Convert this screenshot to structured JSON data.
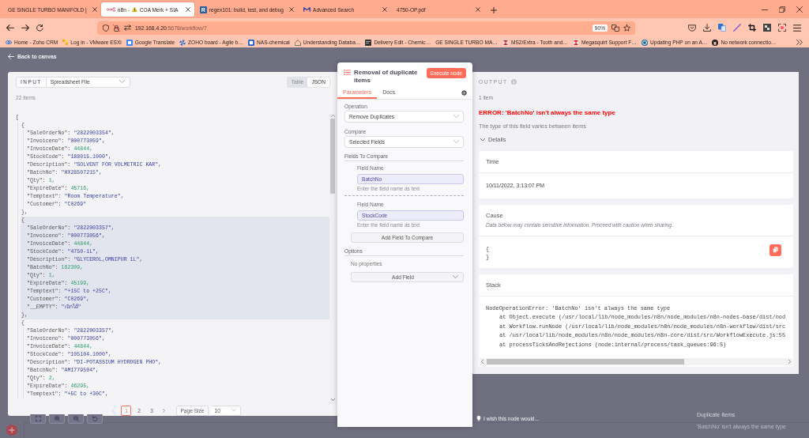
{
  "browser": {
    "tabs": [
      {
        "label": "GE SINGLE TURBO MANIFOLD |",
        "kind": "plain",
        "warning": false,
        "selected": false
      },
      {
        "label": "n8n -",
        "label_2": "COA Merk + SIA",
        "kind": "nodes",
        "warning": true,
        "selected": true
      },
      {
        "label": "regex101: build, test, and debug",
        "kind": "letter",
        "favicon_text": "R",
        "warning": false,
        "selected": false
      },
      {
        "label": "Advanced Search",
        "kind": "zigzag",
        "warning": false,
        "selected": false
      },
      {
        "label": "4750-OP.pdf",
        "kind": "plain",
        "warning": false,
        "selected": false
      }
    ],
    "address": {
      "host": "192.168.4.20",
      "path": ":5678/workflow/7",
      "zoom": "90%"
    },
    "bookmarks": [
      {
        "label": "Home - Zoho CRM",
        "kind": "rings"
      },
      {
        "label": "Log in - VMware ESXi",
        "kind": "squares"
      },
      {
        "label": "Google Translate",
        "kind": "tile"
      },
      {
        "label": "ZOHO board - Agile b…",
        "kind": "pinwheel"
      },
      {
        "label": "NAS-chemical",
        "kind": "screen"
      },
      {
        "label": "Understanding Databa…",
        "kind": "house"
      },
      {
        "label": "Delivery Edit - Chemic…",
        "kind": "terminal"
      },
      {
        "label": "GE SINGLE TURBO MA…",
        "kind": "plain"
      },
      {
        "label": "MS2/Extra - Tooth and…",
        "kind": "hourglass"
      },
      {
        "label": "Megasquirt Support F…",
        "kind": "hourglass"
      },
      {
        "label": "Updating PHP on an A…",
        "kind": "circle"
      },
      {
        "label": "No network connectio…",
        "kind": "cat"
      }
    ]
  },
  "back_link": "Back to canvas",
  "input": {
    "label": "INPUT",
    "source": "Spreadsheet File",
    "views": [
      {
        "label": "Table",
        "selected": false
      },
      {
        "label": "JSON",
        "selected": true
      }
    ],
    "count": "22 items",
    "json": {
      "open": "[",
      "items": [
        {
          "open": "{",
          "close": "},",
          "highlighted": false,
          "fields": [
            {
              "key": "\"SaleOrderNo\":",
              "value": "\"2822003354\",",
              "kind": "string"
            },
            {
              "key": "\"Invoiceno\":",
              "value": "\"000773059\",",
              "kind": "string"
            },
            {
              "key": "\"InvoiceDate\":",
              "value": "44844,",
              "kind": "number"
            },
            {
              "key": "\"StockCode\":",
              "value": "\"188015.1000\",",
              "kind": "string"
            },
            {
              "key": "\"Description\":",
              "value": "\"SOLVENT FOR VOLMETRIC KAR\",",
              "kind": "string"
            },
            {
              "key": "\"BatchNo\":",
              "value": "\"HX28507215\",",
              "kind": "string"
            },
            {
              "key": "\"Qty\":",
              "value": "1,",
              "kind": "number"
            },
            {
              "key": "\"ExpireDate\":",
              "value": "45716,",
              "kind": "number"
            },
            {
              "key": "\"Temptext\":",
              "value": "\"Room Temperature\",",
              "kind": "string"
            },
            {
              "key": "\"Customer\":",
              "value": "\"C0269\"",
              "kind": "string"
            }
          ]
        },
        {
          "open": "{",
          "close": "},",
          "highlighted": true,
          "fields": [
            {
              "key": "\"SaleOrderNo\":",
              "value": "\"2822003357\",",
              "kind": "string"
            },
            {
              "key": "\"Invoiceno\":",
              "value": "\"000773056\",",
              "kind": "string"
            },
            {
              "key": "\"InvoiceDate\":",
              "value": "44844,",
              "kind": "number"
            },
            {
              "key": "\"StockCode\":",
              "value": "\"4750-1L\",",
              "kind": "string"
            },
            {
              "key": "\"Description\":",
              "value": "\"GLYCEROL,OMNIPUR 1L\",",
              "kind": "string"
            },
            {
              "key": "\"BatchNo\":",
              "value": "162309,",
              "kind": "number"
            },
            {
              "key": "\"Qty\":",
              "value": "1,",
              "kind": "number"
            },
            {
              "key": "\"ExpireDate\":",
              "value": "45199,",
              "kind": "number"
            },
            {
              "key": "\"Temptext\":",
              "value": "\"+15C to +25C\",",
              "kind": "string"
            },
            {
              "key": "\"Customer\":",
              "value": "\"C0269\",",
              "kind": "string"
            },
            {
              "key": "\"__EMPTY\":",
              "value": "\"เบิกได้\"",
              "kind": "string"
            }
          ]
        },
        {
          "open": "{",
          "highlighted": false,
          "fields": [
            {
              "key": "\"SaleOrderNo\":",
              "value": "\"2822003357\",",
              "kind": "string"
            },
            {
              "key": "\"Invoiceno\":",
              "value": "\"000773056\",",
              "kind": "string"
            },
            {
              "key": "\"InvoiceDate\":",
              "value": "44844,",
              "kind": "number"
            },
            {
              "key": "\"StockCode\":",
              "value": "\"105104.1000\",",
              "kind": "string"
            },
            {
              "key": "\"Description\":",
              "value": "\"DI-POTASSIUM HYDROGEN PHO\",",
              "kind": "string"
            },
            {
              "key": "\"BatchNo\":",
              "value": "\"AM1779504\",",
              "kind": "string"
            },
            {
              "key": "\"Qty\":",
              "value": "2,",
              "kind": "number"
            },
            {
              "key": "\"ExpireDate\":",
              "value": "46295,",
              "kind": "number"
            },
            {
              "key": "\"Temptext\":",
              "value": "\"+5C to +30C\",",
              "kind": "string"
            }
          ]
        }
      ]
    },
    "pagination": {
      "prev_disabled": true,
      "pages": [
        {
          "label": "1",
          "selected": true
        },
        {
          "label": "2",
          "selected": false
        },
        {
          "label": "3",
          "selected": false
        }
      ],
      "page_size_label": "Page Size",
      "page_size": "10"
    }
  },
  "parameters_panel": {
    "title": "Removal of duplicate items",
    "execute": "Execute node",
    "tabs": [
      {
        "label": "Parameters",
        "selected": true
      },
      {
        "label": "Docs",
        "selected": false
      }
    ],
    "items": [
      {
        "kind": "select",
        "label": "Operation",
        "value": "Remove Duplicates"
      },
      {
        "kind": "select",
        "label": "Compare",
        "value": "Selected Fields"
      },
      {
        "kind": "section",
        "label": "Fields To Compare"
      },
      {
        "kind": "text_input",
        "label": "Field Name",
        "value": "BatchNo",
        "hint": "Enter the field name as text"
      },
      {
        "kind": "text_input",
        "label": "Field Name",
        "value": "StockCode",
        "hint": "Enter the field name as text"
      },
      {
        "kind": "button",
        "label": "Add Field To Compare"
      },
      {
        "kind": "section",
        "label": "Options"
      },
      {
        "kind": "note",
        "label": "No properties"
      },
      {
        "kind": "dropdown_button",
        "label": "Add Field"
      }
    ]
  },
  "output": {
    "label": "OUTPUT",
    "count": "1 item",
    "error": "ERROR: 'BatchNo' isn't always the same type",
    "description": "The type of this field varies between items",
    "details": {
      "label": "Details",
      "expanded": true
    },
    "cards": [
      {
        "kind": "text",
        "title": "Time",
        "value": "10/11/2022, 3:13:07 PM"
      },
      {
        "kind": "code",
        "title": "Cause",
        "note": "Data below may contain sensitive information. Proceed with caution when sharing.",
        "lines": [
          "{",
          "}"
        ]
      },
      {
        "kind": "stack",
        "title": "Stack",
        "message": "NodeOperationError: 'BatchNo' isn't always the same type",
        "frames": [
          "at Object.execute (/usr/local/lib/node_modules/n8n/node_modules/n8n-nodes-base/dist/nod",
          "at Workflow.runNode (/usr/local/lib/node_modules/n8n/node_modules/n8n-workflow/dist/src",
          "at /usr/local/lib/node_modules/n8n/node_modules/n8n-core/dist/src/WorkflowExecute.js:55",
          "at processTicksAndRejections (node:internal/process/task_queues:96:5)"
        ]
      }
    ]
  },
  "canvas": {
    "node_title": "Duplicate Items",
    "node_subtitle": "'BatchNo' isn't always the same type",
    "feedback": "I wish this node would..."
  }
}
